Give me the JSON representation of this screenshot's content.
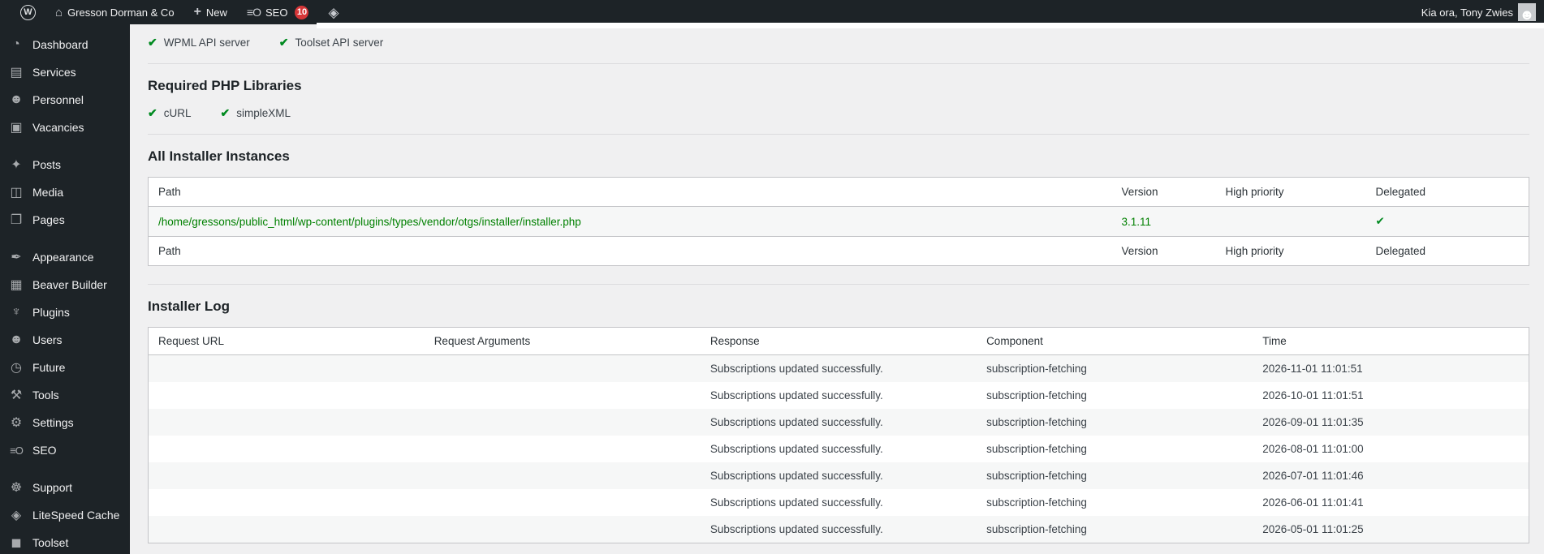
{
  "colors": {
    "check_green": "#008a20",
    "path_green": "#008000",
    "badge_red": "#d63638",
    "bar_bg": "#1d2327",
    "content_bg": "#f0f0f1"
  },
  "admin_bar": {
    "wp_logo": "W",
    "home_icon": "⌂",
    "site_name": "Gresson Dorman & Co",
    "new_icon": "+",
    "new_label": "New",
    "seo_icon": "≡O",
    "seo_label": "SEO",
    "seo_badge": "10",
    "litespeed_icon": "◈",
    "greeting": "Kia ora, Tony Zwies",
    "avatar_glyph": "☻"
  },
  "sidebar": {
    "groups": [
      {
        "items": [
          {
            "icon": "◔",
            "label": "Dashboard"
          },
          {
            "icon": "▤",
            "label": "Services"
          },
          {
            "icon": "☻",
            "label": "Personnel"
          },
          {
            "icon": "▣",
            "label": "Vacancies"
          }
        ]
      },
      {
        "items": [
          {
            "icon": "✦",
            "label": "Posts"
          },
          {
            "icon": "◫",
            "label": "Media"
          },
          {
            "icon": "❐",
            "label": "Pages"
          }
        ]
      },
      {
        "items": [
          {
            "icon": "✒",
            "label": "Appearance"
          },
          {
            "icon": "▦",
            "label": "Beaver Builder"
          },
          {
            "icon": "♆",
            "label": "Plugins"
          },
          {
            "icon": "☻",
            "label": "Users"
          },
          {
            "icon": "◷",
            "label": "Future"
          },
          {
            "icon": "⚒",
            "label": "Tools"
          },
          {
            "icon": "⚙",
            "label": "Settings"
          },
          {
            "icon": "≡O",
            "label": "SEO"
          }
        ]
      },
      {
        "items": [
          {
            "icon": "☸",
            "label": "Support"
          },
          {
            "icon": "◈",
            "label": "LiteSpeed Cache"
          },
          {
            "icon": "◼",
            "label": "Toolset"
          }
        ]
      }
    ]
  },
  "main": {
    "api_checks": {
      "check_glyph": "✔",
      "items": [
        "WPML API server",
        "Toolset API server"
      ]
    },
    "php_section": {
      "title": "Required PHP Libraries",
      "items": [
        "cURL",
        "simpleXML"
      ]
    },
    "instances_section": {
      "title": "All Installer Instances",
      "columns": {
        "path": "Path",
        "version": "Version",
        "high_priority": "High priority",
        "delegated": "Delegated"
      },
      "row": {
        "path": "/home/gressons/public_html/wp-content/plugins/types/vendor/otgs/installer/installer.php",
        "version": "3.1.11",
        "high_priority": "",
        "delegated": "✔"
      }
    },
    "log_section": {
      "title": "Installer Log",
      "columns": {
        "request_url": "Request URL",
        "request_arguments": "Request Arguments",
        "response": "Response",
        "component": "Component",
        "time": "Time"
      },
      "rows": [
        {
          "request_url": "",
          "request_arguments": "",
          "response": "Subscriptions updated successfully.",
          "component": "subscription-fetching",
          "time": "2026-11-01 11:01:51"
        },
        {
          "request_url": "",
          "request_arguments": "",
          "response": "Subscriptions updated successfully.",
          "component": "subscription-fetching",
          "time": "2026-10-01 11:01:51"
        },
        {
          "request_url": "",
          "request_arguments": "",
          "response": "Subscriptions updated successfully.",
          "component": "subscription-fetching",
          "time": "2026-09-01 11:01:35"
        },
        {
          "request_url": "",
          "request_arguments": "",
          "response": "Subscriptions updated successfully.",
          "component": "subscription-fetching",
          "time": "2026-08-01 11:01:00"
        },
        {
          "request_url": "",
          "request_arguments": "",
          "response": "Subscriptions updated successfully.",
          "component": "subscription-fetching",
          "time": "2026-07-01 11:01:46"
        },
        {
          "request_url": "",
          "request_arguments": "",
          "response": "Subscriptions updated successfully.",
          "component": "subscription-fetching",
          "time": "2026-06-01 11:01:41"
        },
        {
          "request_url": "",
          "request_arguments": "",
          "response": "Subscriptions updated successfully.",
          "component": "subscription-fetching",
          "time": "2026-05-01 11:01:25"
        }
      ]
    }
  }
}
